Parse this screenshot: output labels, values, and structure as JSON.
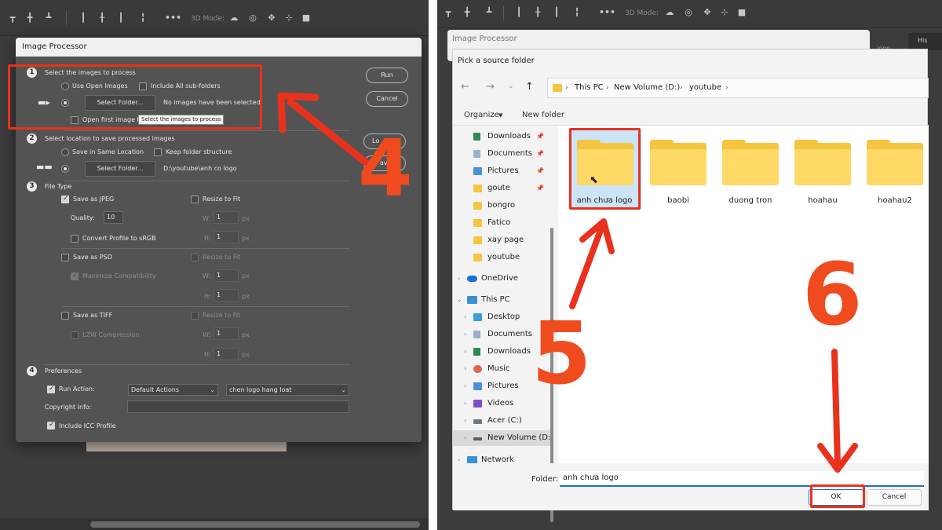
{
  "left": {
    "toolbar": {
      "mode_label": "3D Mode:"
    },
    "dialog": {
      "title": "Image Processor",
      "sections": {
        "s1": {
          "num": "1",
          "title": "Select the images to process"
        },
        "s2": {
          "num": "2",
          "title": "Select location to save processed images"
        },
        "s3": {
          "num": "3",
          "title": "File Type"
        },
        "s4": {
          "num": "4",
          "title": "Preferences"
        }
      },
      "use_open_images": "Use Open Images",
      "include_subfolders": "Include All sub-folders",
      "select_folder_btn": "Select Folder...",
      "no_images": "No images have been selected",
      "open_first_image": "Open first image t",
      "tooltip": "Select the images to process",
      "save_same_location": "Save in Same Location",
      "keep_folder_structure": "Keep folder structure",
      "save_path": "D:\\youtube\\anh co logo",
      "save_jpeg": "Save as JPEG",
      "resize_to_fit": "Resize to Fit",
      "quality_label": "Quality:",
      "quality_value": "10",
      "w_label": "W:",
      "h_label": "H:",
      "px": "px",
      "size_value": "1",
      "convert_srgb": "Convert Profile to sRGB",
      "save_psd": "Save as PSD",
      "max_compat": "Maximize Compatibility",
      "save_tiff": "Save as TIFF",
      "lzw": "LZW Compression",
      "run_action": "Run Action:",
      "action_set": "Default Actions",
      "action_name": "chen logo hang loat",
      "copyright_label": "Copyright Info:",
      "copyright_value": "",
      "include_icc": "Include ICC Profile",
      "run_btn": "Run",
      "cancel_btn": "Cancel",
      "load_btn_partial": "Lo",
      "save_btn_partial": "ave..."
    },
    "annotation_number": "4"
  },
  "right": {
    "toolbar": {
      "mode_label": "3D Mode:"
    },
    "bg_dialog_title": "Image Processor",
    "bg_panel_tab": "His",
    "bg_text": "logo",
    "picker": {
      "title": "Pick a source folder",
      "breadcrumb": [
        "This PC",
        "New Volume (D:)",
        "youtube"
      ],
      "organize": "Organize",
      "new_folder": "New folder",
      "nav_quick": [
        {
          "label": "Downloads",
          "icon": "download-icon",
          "pinned": true
        },
        {
          "label": "Documents",
          "icon": "documents-icon",
          "pinned": true
        },
        {
          "label": "Pictures",
          "icon": "pictures-icon",
          "pinned": true
        },
        {
          "label": "goute",
          "icon": "folder-icon",
          "pinned": true
        },
        {
          "label": "bongro",
          "icon": "folder-icon",
          "pinned": false
        },
        {
          "label": "Fatico",
          "icon": "folder-icon",
          "pinned": false
        },
        {
          "label": "xay page",
          "icon": "folder-icon",
          "pinned": false
        },
        {
          "label": "youtube",
          "icon": "folder-icon",
          "pinned": false
        }
      ],
      "onedrive": "OneDrive",
      "this_pc": "This PC",
      "pc_items": [
        "Desktop",
        "Documents",
        "Downloads",
        "Music",
        "Pictures",
        "Videos",
        "Acer (C:)",
        "New Volume (D:"
      ],
      "network": "Network",
      "folders": [
        "anh chưa logo",
        "baobi",
        "duong tron",
        "hoahau",
        "hoahau2"
      ],
      "folder_label": "Folder:",
      "folder_value": "anh chưa logo",
      "ok_btn": "OK",
      "cancel_btn": "Cancel"
    },
    "annotation_numbers": [
      "5",
      "6"
    ]
  },
  "colors": {
    "annotation": "#e8321e",
    "ps_dialog": "#535353",
    "selection": "#cce4f7",
    "folder": "#ffd865"
  }
}
